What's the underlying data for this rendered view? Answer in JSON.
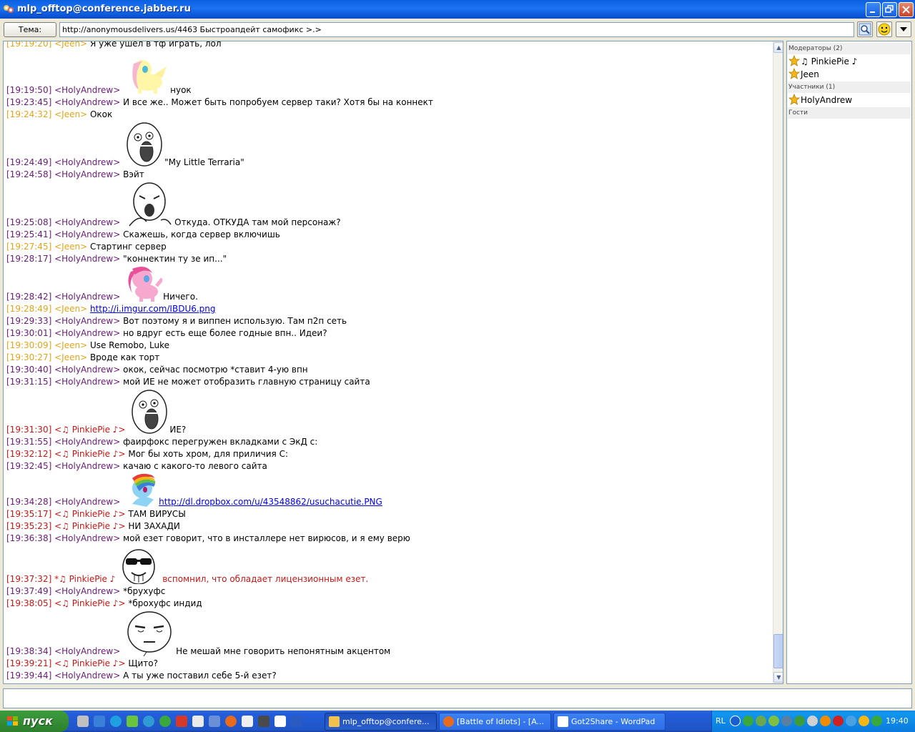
{
  "window": {
    "title": "mlp_offtop@conference.jabber.ru"
  },
  "topic": {
    "button_label": "Тема:",
    "value": "http://anonymousdelivers.us/4463 Быстроапдейт самофикс >.>"
  },
  "chat": {
    "messages": [
      {
        "time": "[19:19:20]",
        "nick": "<Jeen>",
        "role": "jeen",
        "text": "Я уже ушел в тф играть, лол"
      },
      {
        "time": "[19:19:50]",
        "nick": "<HolyAndrew>",
        "role": "holy",
        "text": "нуок",
        "sticker": "fluttershy"
      },
      {
        "time": "[19:23:45]",
        "nick": "<HolyAndrew>",
        "role": "holy",
        "text": "И все же.. Может быть попробуем сервер таки? Хотя бы на коннект"
      },
      {
        "time": "[19:24:32]",
        "nick": "<Jeen>",
        "role": "jeen",
        "text": "Окок"
      },
      {
        "time": "[19:24:49]",
        "nick": "<HolyAndrew>",
        "role": "holy",
        "text": "\"My Little Terraria\"",
        "sticker": "lol-face"
      },
      {
        "time": "[19:24:58]",
        "nick": "<HolyAndrew>",
        "role": "holy",
        "text": "Вэйт"
      },
      {
        "time": "[19:25:08]",
        "nick": "<HolyAndrew>",
        "role": "holy",
        "text": "Откуда. ОТКУДА там мой персонаж?",
        "sticker": "y-u-no-face"
      },
      {
        "time": "[19:25:41]",
        "nick": "<HolyAndrew>",
        "role": "holy",
        "text": "Скажешь, когда сервер включишь"
      },
      {
        "time": "[19:27:45]",
        "nick": "<Jeen>",
        "role": "jeen",
        "text": "Стартинг сервер"
      },
      {
        "time": "[19:28:17]",
        "nick": "<HolyAndrew>",
        "role": "holy",
        "text": "\"коннектин ту зе ип...\""
      },
      {
        "time": "[19:28:42]",
        "nick": "<HolyAndrew>",
        "role": "holy",
        "text": "Ничего.",
        "sticker": "pinkie"
      },
      {
        "time": "[19:28:49]",
        "nick": "<Jeen>",
        "role": "jeen",
        "link": "http://i.imgur.com/IBDU6.png"
      },
      {
        "time": "[19:29:33]",
        "nick": "<HolyAndrew>",
        "role": "holy",
        "text": "Вот поэтому я и виппен использую. Там п2п сеть"
      },
      {
        "time": "[19:30:01]",
        "nick": "<HolyAndrew>",
        "role": "holy",
        "text": "но вдруг есть еще более годные впн.. Идеи?"
      },
      {
        "time": "[19:30:09]",
        "nick": "<Jeen>",
        "role": "jeen",
        "text": "Use Remobo, Luke"
      },
      {
        "time": "[19:30:27]",
        "nick": "<Jeen>",
        "role": "jeen",
        "text": "Вроде как торт"
      },
      {
        "time": "[19:30:40]",
        "nick": "<HolyAndrew>",
        "role": "holy",
        "text": "окок, сейчас посмотрю *ставит 4-ую впн"
      },
      {
        "time": "[19:31:15]",
        "nick": "<HolyAndrew>",
        "role": "holy",
        "text": "мой ИЕ не может отобразить главную страницу сайта"
      },
      {
        "time": "[19:31:30]",
        "nick": "<♫ PinkiePie ♪>",
        "role": "pinkie",
        "text": "ИЕ?",
        "sticker": "lol-face"
      },
      {
        "time": "[19:31:55]",
        "nick": "<HolyAndrew>",
        "role": "holy",
        "text": "фаирфокс перегружен вкладками с ЭкД с:"
      },
      {
        "time": "[19:32:12]",
        "nick": "<♫ PinkiePie ♪>",
        "role": "pinkie",
        "text": "Мог бы хоть хром, для приличия С:"
      },
      {
        "time": "[19:32:45]",
        "nick": "<HolyAndrew>",
        "role": "holy",
        "text": "качаю с какого-то левого сайта"
      },
      {
        "time": "[19:34:28]",
        "nick": "<HolyAndrew>",
        "role": "holy",
        "link": "http://dl.dropbox.com/u/43548862/usuchacutie.PNG",
        "sticker": "rainbow-dash"
      },
      {
        "time": "[19:35:17]",
        "nick": "<♫ PinkiePie ♪>",
        "role": "pinkie",
        "text": "ТАМ ВИРУСЫ"
      },
      {
        "time": "[19:35:23]",
        "nick": "<♫ PinkiePie ♪>",
        "role": "pinkie",
        "text": "НИ ЗАХАДИ"
      },
      {
        "time": "[19:36:38]",
        "nick": "<HolyAndrew>",
        "role": "holy",
        "text": "мой езет говорит, что в инсталлере нет вирюсов, и я ему верю"
      },
      {
        "time": "[19:37:32]",
        "nick": "*♫ PinkiePie ♪",
        "role": "pinkie",
        "text": "вспомнил, что обладает лицензионным езет.",
        "is_action": true,
        "sticker": "deal-with-it-face"
      },
      {
        "time": "[19:37:49]",
        "nick": "<HolyAndrew>",
        "role": "holy",
        "text": "*брухуфс"
      },
      {
        "time": "[19:38:05]",
        "nick": "<♫ PinkiePie ♪>",
        "role": "pinkie",
        "text": "*брохуфс индид"
      },
      {
        "time": "[19:38:34]",
        "nick": "<HolyAndrew>",
        "role": "holy",
        "text": "Не мешай мне говорить непонятным акцентом",
        "sticker": "are-you-serious-face"
      },
      {
        "time": "[19:39:21]",
        "nick": "<♫ PinkiePie ♪>",
        "role": "pinkie",
        "text": "Щито?"
      },
      {
        "time": "[19:39:44]",
        "nick": "<HolyAndrew>",
        "role": "holy",
        "text": "А ты уже поставил себе 5-й езет?"
      }
    ]
  },
  "roster": {
    "groups": [
      {
        "label": "Модераторы  (2)",
        "members": [
          "♫ PinkiePie ♪",
          "Jeen"
        ]
      },
      {
        "label": "Участники  (1)",
        "members": [
          "HolyAndrew"
        ]
      },
      {
        "label": "Гости",
        "members": []
      }
    ]
  },
  "taskbar": {
    "start_label": "пуск",
    "tasks": [
      {
        "label": "mlp_offtop@confere...",
        "active": true
      },
      {
        "label": "[Battle of Idiots] - [A...",
        "active": false
      },
      {
        "label": "Got2Share - WordPad",
        "active": false
      }
    ],
    "tray": {
      "lang": "RL",
      "clock": "19:40"
    }
  },
  "colors": {
    "holy": "#6a1b78",
    "jeen": "#e3a51a",
    "pinkie": "#c71616",
    "link": "#0000ee",
    "titlebar": "#0a5fe0",
    "taskbar": "#245edb",
    "start": "#379137"
  },
  "icons": {
    "titlebar": "jabber-icon",
    "tool_buttons": [
      "search-icon",
      "smiley-icon",
      "dropdown-arrow-icon"
    ],
    "roster_status": "star-icon"
  }
}
